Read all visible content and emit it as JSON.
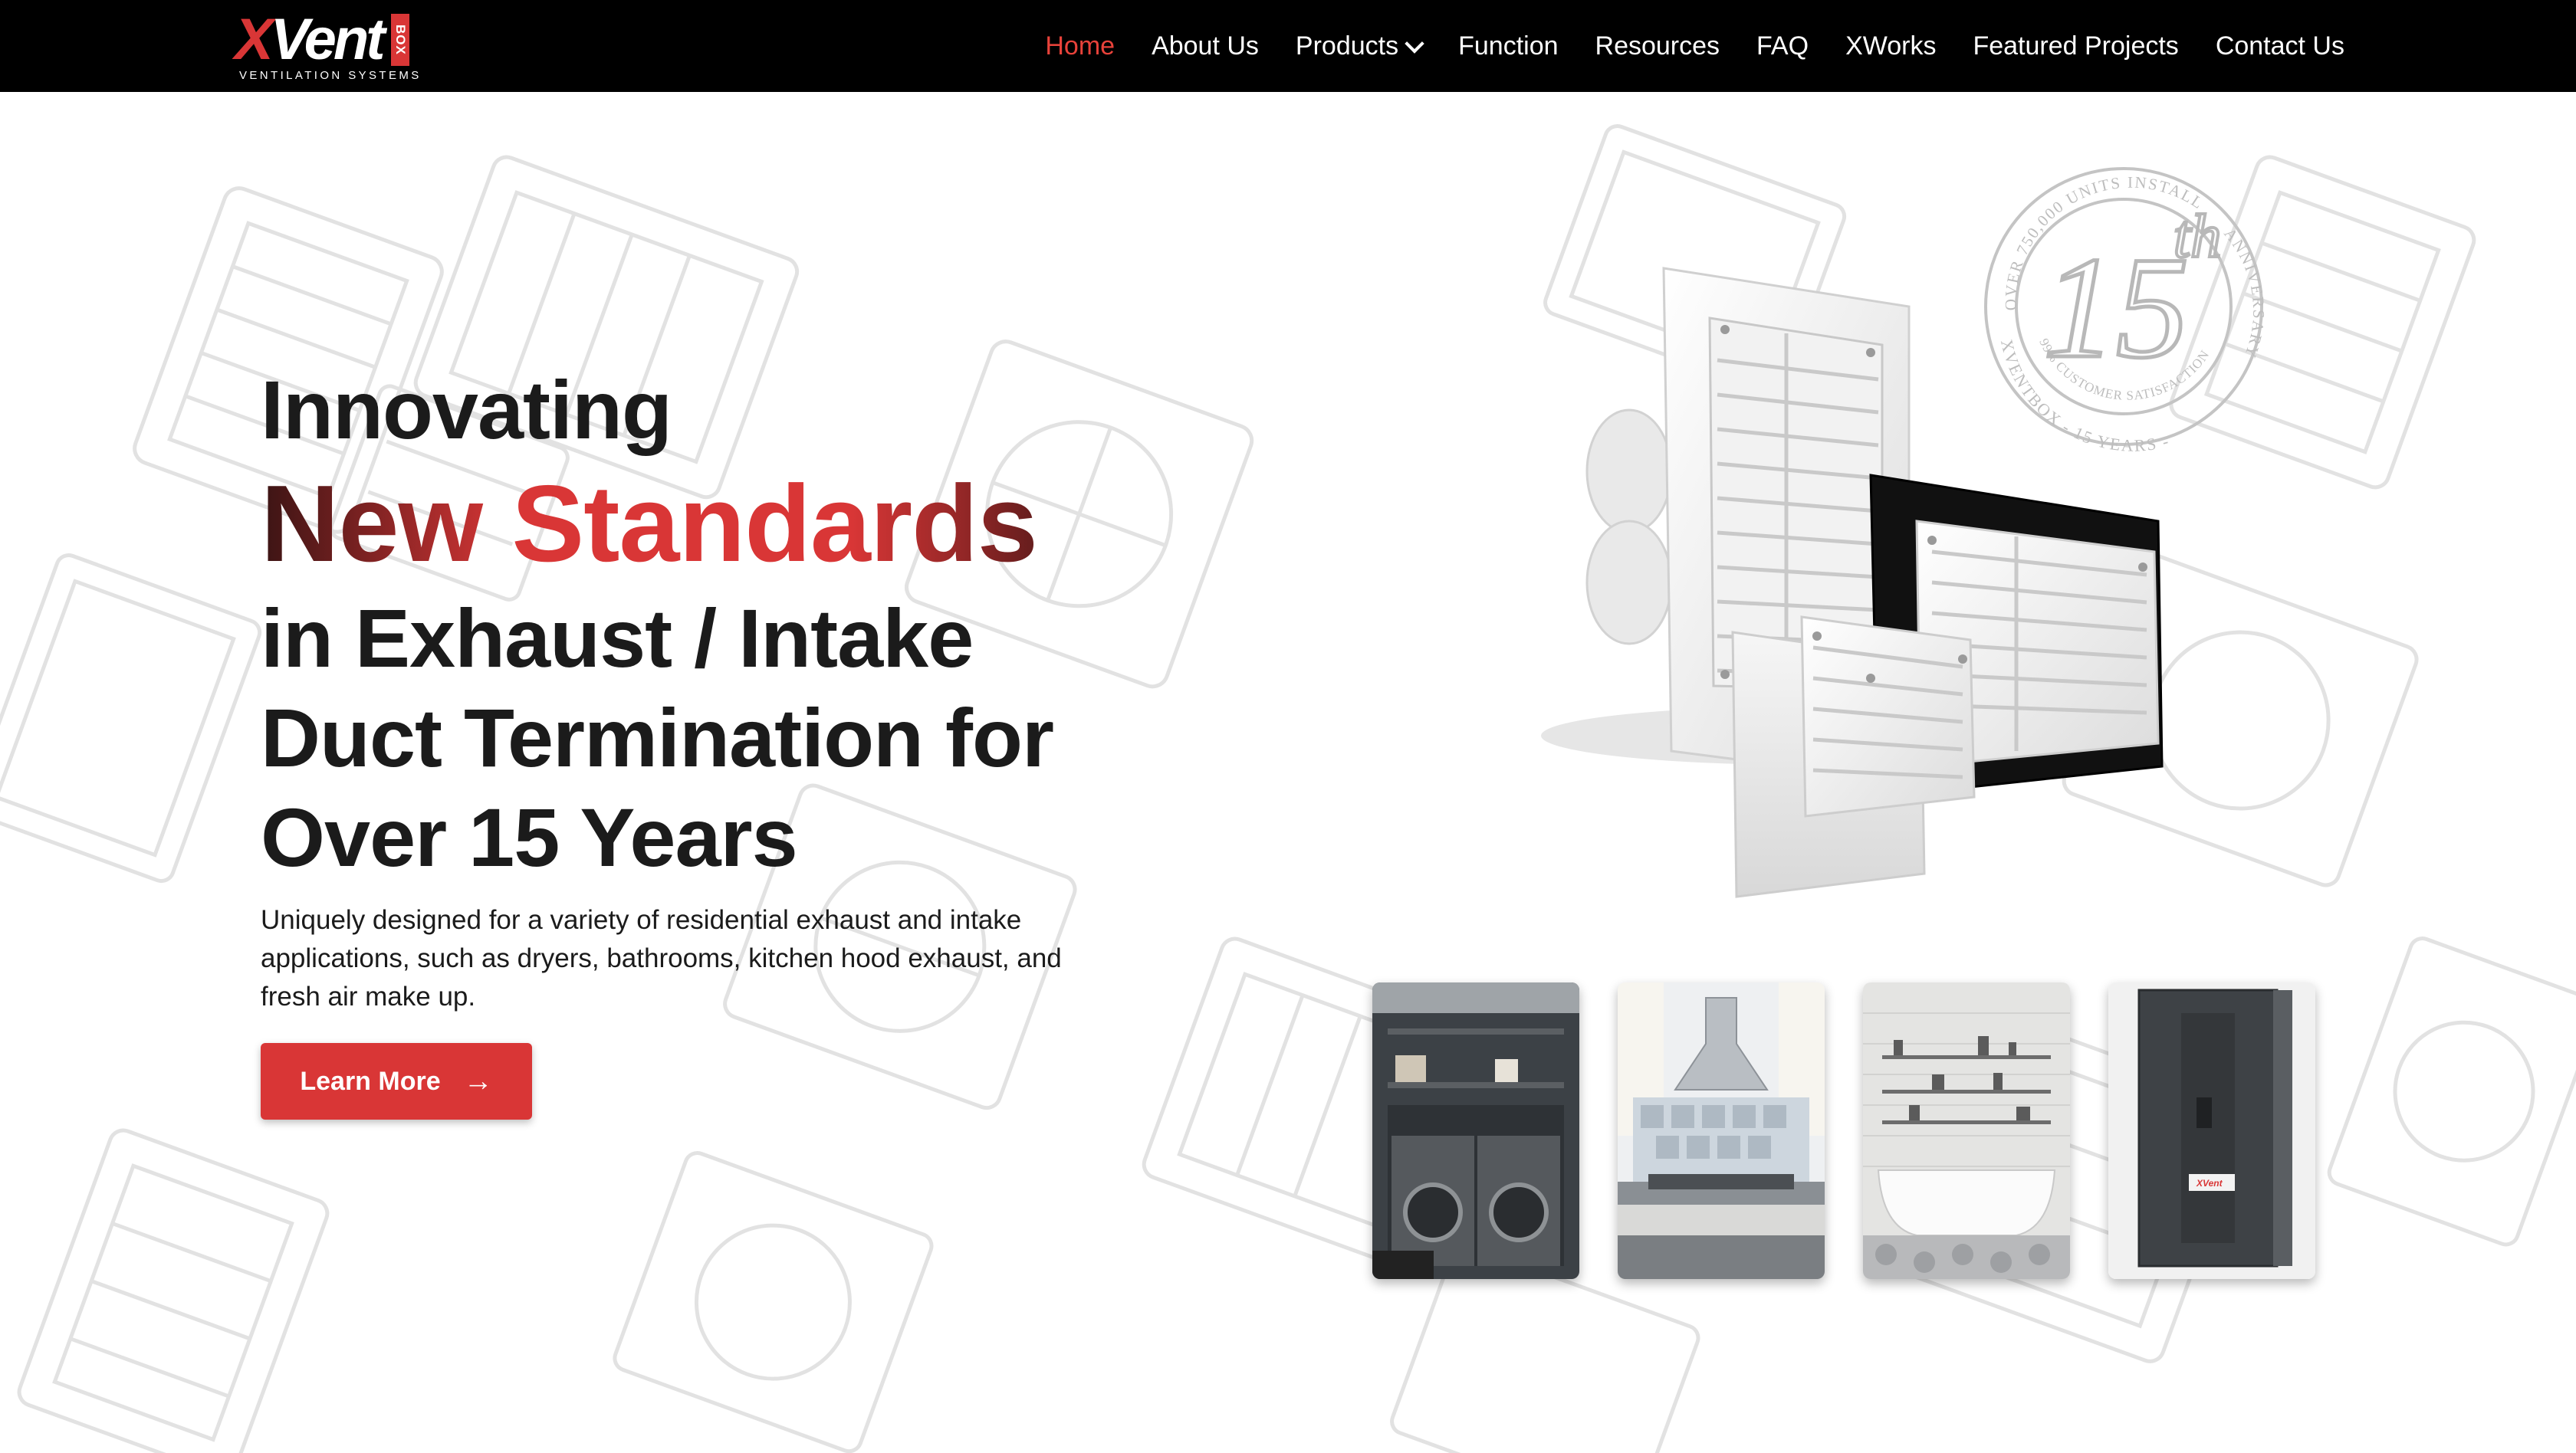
{
  "logo": {
    "brand_x": "X",
    "brand_vent": "Vent",
    "brand_box": "BOX",
    "tagline": "VENTILATION SYSTEMS"
  },
  "nav": {
    "items": [
      {
        "label": "Home",
        "active": true
      },
      {
        "label": "About Us"
      },
      {
        "label": "Products",
        "has_dropdown": true
      },
      {
        "label": "Function"
      },
      {
        "label": "Resources"
      },
      {
        "label": "FAQ"
      },
      {
        "label": "XWorks"
      },
      {
        "label": "Featured Projects"
      },
      {
        "label": "Contact Us"
      }
    ]
  },
  "hero": {
    "line1": "Innovating",
    "line2": "New Standards",
    "line3": "in Exhaust / Intake",
    "line4": "Duct Termination for",
    "line5": "Over 15 Years",
    "subtitle": "Uniquely designed for a variety of residential exhaust and intake applications, such as dryers, bathrooms, kitchen hood exhaust, and fresh air make up.",
    "cta_label": "Learn More",
    "cta_icon": "arrow-right-icon"
  },
  "badge": {
    "top_text": "OVER 750,000 UNITS INSTALLED",
    "side_text": "ANNIVERSARY",
    "mid_text": "99% CUSTOMER SATISFACTION RATING",
    "bottom_text": "XVENTBOX - 15 YEARS -",
    "number": "15",
    "suffix": "th"
  },
  "thumbnails": [
    {
      "name": "laundry-room"
    },
    {
      "name": "kitchen-hood"
    },
    {
      "name": "bathroom"
    },
    {
      "name": "air-handler"
    }
  ],
  "colors": {
    "accent": "#d93636",
    "nav_bg": "#000000",
    "nav_active": "#e8423a",
    "text": "#1b1b1b"
  }
}
